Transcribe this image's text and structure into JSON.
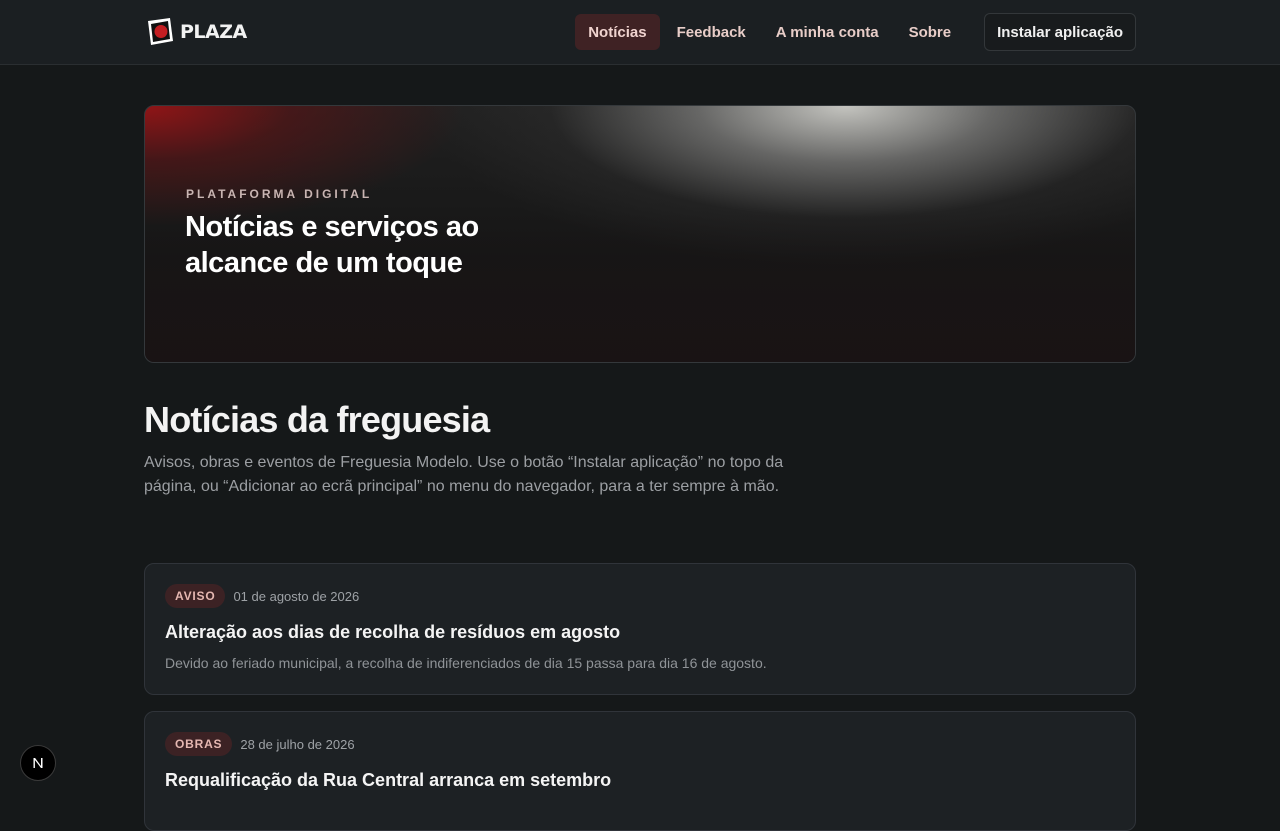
{
  "brand": {
    "name": "PLAZA",
    "accent": "#c41e22"
  },
  "nav": {
    "items": [
      {
        "label": "Notícias",
        "active": true
      },
      {
        "label": "Feedback",
        "active": false
      },
      {
        "label": "A minha conta",
        "active": false
      },
      {
        "label": "Sobre",
        "active": false
      }
    ],
    "install_label": "Instalar aplicação"
  },
  "hero": {
    "eyebrow": "PLATAFORMA DIGITAL",
    "title": "Notícias e serviços ao alcance de um toque"
  },
  "section": {
    "title": "Notícias da freguesia",
    "description": "Avisos, obras e eventos de Freguesia Modelo. Use o botão “Instalar aplicação” no topo da página, ou “Adicionar ao ecrã principal” no menu do navegador, para a ter sempre à mão."
  },
  "news": [
    {
      "tag": "AVISO",
      "date": "01 de agosto de 2026",
      "title": "Alteração aos dias de recolha de resíduos em agosto",
      "summary": "Devido ao feriado municipal, a recolha de indiferenciados de dia 15 passa para dia 16 de agosto."
    },
    {
      "tag": "OBRAS",
      "date": "28 de julho de 2026",
      "title": "Requalificação da Rua Central arranca em setembro",
      "summary": ""
    }
  ],
  "floating": {
    "icon": "next-logo-icon",
    "letter": "N"
  }
}
